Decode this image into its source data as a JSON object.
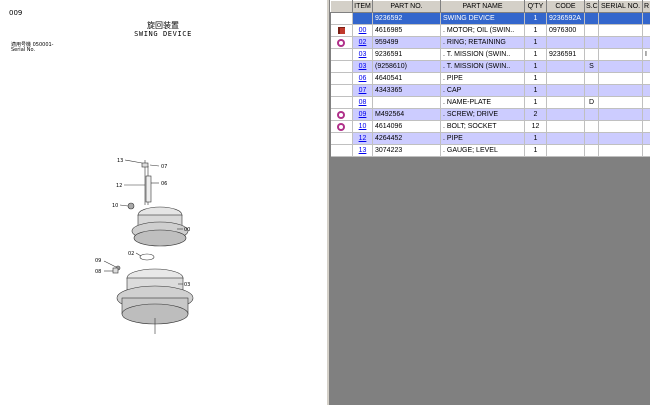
{
  "drawing": {
    "page_no": "009",
    "title_jp": "旋回装置",
    "title_en": "SWING DEVICE",
    "applicable_model_label": "適用号機  050001-",
    "serial_label": "Serial No.",
    "callouts": [
      "13",
      "07",
      "12",
      "06",
      "10",
      "00",
      "02",
      "09",
      "08",
      "03"
    ]
  },
  "table": {
    "columns": [
      "",
      "ITEM",
      "PART NO.",
      "PART NAME",
      "Q'TY",
      "CODE",
      "S.C",
      "SERIAL NO.",
      "R"
    ],
    "rows": [
      {
        "icon": "",
        "item": "",
        "part_no": "9236592",
        "part_name": "SWING DEVICE",
        "qty": "1",
        "code": "9236592A",
        "sc": "",
        "serial": "",
        "r": "",
        "style": "sel",
        "link": false
      },
      {
        "icon": "book-icon",
        "item": "00",
        "part_no": "4616985",
        "part_name": ". MOTOR; OIL (SWIN..",
        "qty": "1",
        "code": "0976300",
        "sc": "",
        "serial": "",
        "r": "",
        "style": "",
        "link": true
      },
      {
        "icon": "gear-icon",
        "item": "02",
        "part_no": "959499",
        "part_name": ". RING; RETAINING",
        "qty": "1",
        "code": "",
        "sc": "",
        "serial": "",
        "r": "",
        "style": "alt",
        "link": true
      },
      {
        "icon": "",
        "item": "03",
        "part_no": "9236591",
        "part_name": ". T. MISSION (SWIN..",
        "qty": "1",
        "code": "9236591",
        "sc": "",
        "serial": "",
        "r": "I",
        "style": "",
        "link": true
      },
      {
        "icon": "",
        "item": "03",
        "part_no": "(9258610)",
        "part_name": ". T. MISSION (SWIN..",
        "qty": "1",
        "code": "",
        "sc": "S",
        "serial": "",
        "r": "",
        "style": "alt",
        "link": true
      },
      {
        "icon": "",
        "item": "06",
        "part_no": "4640541",
        "part_name": ". PIPE",
        "qty": "1",
        "code": "",
        "sc": "",
        "serial": "",
        "r": "",
        "style": "",
        "link": true
      },
      {
        "icon": "",
        "item": "07",
        "part_no": "4343365",
        "part_name": ". CAP",
        "qty": "1",
        "code": "",
        "sc": "",
        "serial": "",
        "r": "",
        "style": "alt",
        "link": true
      },
      {
        "icon": "",
        "item": "08",
        "part_no": "",
        "part_name": ". NAME-PLATE",
        "qty": "1",
        "code": "",
        "sc": "D",
        "serial": "",
        "r": "",
        "style": "",
        "link": true
      },
      {
        "icon": "gear-icon",
        "item": "09",
        "part_no": "M492564",
        "part_name": ". SCREW; DRIVE",
        "qty": "2",
        "code": "",
        "sc": "",
        "serial": "",
        "r": "",
        "style": "alt",
        "link": true
      },
      {
        "icon": "gear-icon",
        "item": "10",
        "part_no": "4614096",
        "part_name": ". BOLT; SOCKET",
        "qty": "12",
        "code": "",
        "sc": "",
        "serial": "",
        "r": "",
        "style": "",
        "link": true
      },
      {
        "icon": "",
        "item": "12",
        "part_no": "4264452",
        "part_name": ". PIPE",
        "qty": "1",
        "code": "",
        "sc": "",
        "serial": "",
        "r": "",
        "style": "alt",
        "link": true
      },
      {
        "icon": "",
        "item": "13",
        "part_no": "3074223",
        "part_name": ". GAUGE; LEVEL",
        "qty": "1",
        "code": "",
        "sc": "",
        "serial": "",
        "r": "",
        "style": "",
        "link": true
      }
    ]
  }
}
